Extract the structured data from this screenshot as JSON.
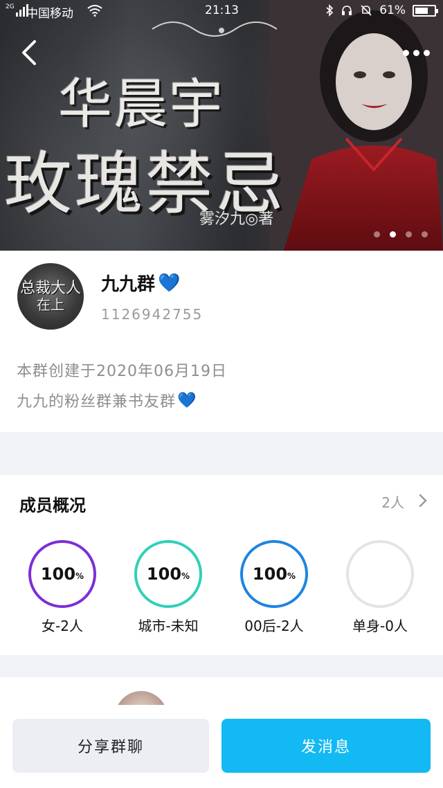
{
  "status_bar": {
    "signal_label": "2G",
    "carrier": "中国移动",
    "time": "21:13",
    "battery": "61%"
  },
  "banner": {
    "title_line1": "华晨宇",
    "title_line2": "玫瑰禁忌",
    "author": "雾汐九◎著",
    "slide_count": 4,
    "active_slide": 2
  },
  "group": {
    "avatar_text_line1": "总裁大人",
    "avatar_text_line2": "在上",
    "name": "九九群",
    "name_emoji": "💙",
    "id": "1126942755",
    "created": "本群创建于2020年06月19日",
    "description": "九九的粉丝群兼书友群",
    "description_emoji": "💙"
  },
  "members": {
    "title": "成员概况",
    "count": "2人",
    "stats": [
      {
        "percent": "100",
        "unit": "%",
        "label": "女-2人",
        "color": "#7b2fd6",
        "fill": 1.0
      },
      {
        "percent": "100",
        "unit": "%",
        "label": "城市-未知",
        "color": "#2fd0b8",
        "fill": 1.0
      },
      {
        "percent": "100",
        "unit": "%",
        "label": "00后-2人",
        "color": "#1f84e0",
        "fill": 1.0
      },
      {
        "percent": "",
        "unit": "",
        "label": "单身-0人",
        "color": "#e3e4e8",
        "fill": 0.0
      }
    ]
  },
  "actions": {
    "share": "分享群聊",
    "send": "发消息"
  },
  "colors": {
    "accent": "#13b9f2",
    "page_bg": "#f2f3f6"
  }
}
